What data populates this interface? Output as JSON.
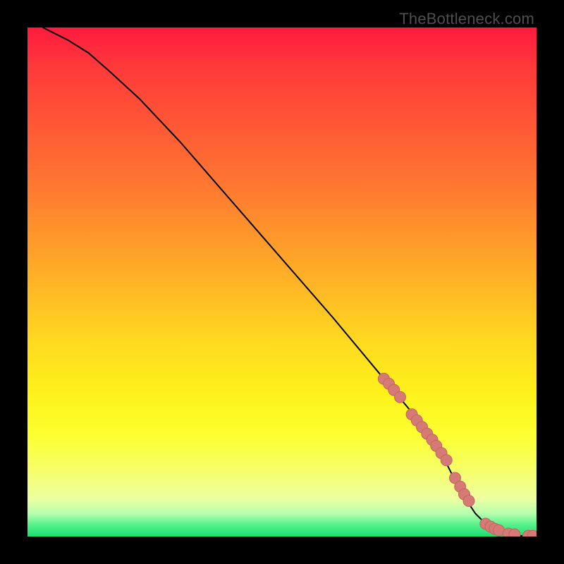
{
  "watermark": "TheBottleneck.com",
  "colors": {
    "curve": "#000000",
    "marker_fill": "#d57a75",
    "marker_stroke": "#c06660"
  },
  "chart_data": {
    "type": "line",
    "title": "",
    "xlabel": "",
    "ylabel": "",
    "xlim": [
      0,
      100
    ],
    "ylim": [
      0,
      100
    ],
    "series": [
      {
        "name": "curve",
        "x": [
          3,
          5,
          8,
          12,
          16,
          22,
          30,
          40,
          50,
          60,
          70,
          75,
          79,
          82,
          84,
          86,
          88,
          90,
          92,
          94,
          96,
          98,
          100
        ],
        "y": [
          100,
          99,
          97.5,
          95,
          91.5,
          86,
          77.5,
          66,
          54.5,
          43,
          31,
          25,
          20,
          15,
          11,
          7.5,
          4.5,
          2.5,
          1.2,
          0.5,
          0.2,
          0.1,
          0.1
        ]
      }
    ],
    "markers": {
      "name": "highlighted-points",
      "x": [
        70,
        71,
        72,
        73.2,
        75.5,
        76.5,
        77.5,
        78.5,
        79.5,
        80.3,
        81.3,
        82.3,
        84,
        85,
        85.8,
        86.7,
        90,
        91,
        91.8,
        92.6,
        94.5,
        95.7,
        98.4,
        99.3
      ],
      "y": [
        31,
        30,
        28.8,
        27.4,
        24,
        22.8,
        21.5,
        20.2,
        19,
        17.8,
        16.4,
        15,
        11.5,
        9.8,
        8.3,
        7,
        2.5,
        1.9,
        1.5,
        1.2,
        0.55,
        0.4,
        0.12,
        0.1
      ]
    }
  }
}
